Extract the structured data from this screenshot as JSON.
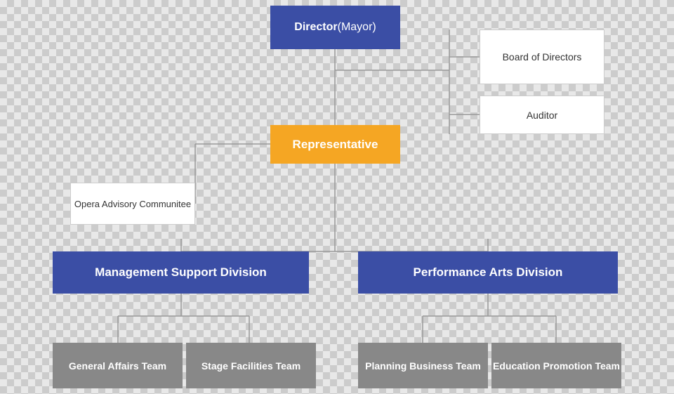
{
  "director": {
    "label": "Director",
    "subtitle": "(Mayor)"
  },
  "representative": {
    "label": "Representative"
  },
  "board": {
    "label": "Board of Directors"
  },
  "auditor": {
    "label": "Auditor"
  },
  "opera": {
    "label": "Opera Advisory Communitee"
  },
  "mgmt": {
    "label": "Management Support Division"
  },
  "perf": {
    "label": "Performance Arts Division"
  },
  "general": {
    "label": "General Affairs Team"
  },
  "stage": {
    "label": "Stage Facilities Team"
  },
  "planning": {
    "label": "Planning Business Team"
  },
  "education": {
    "label": "Education Promotion Team"
  }
}
